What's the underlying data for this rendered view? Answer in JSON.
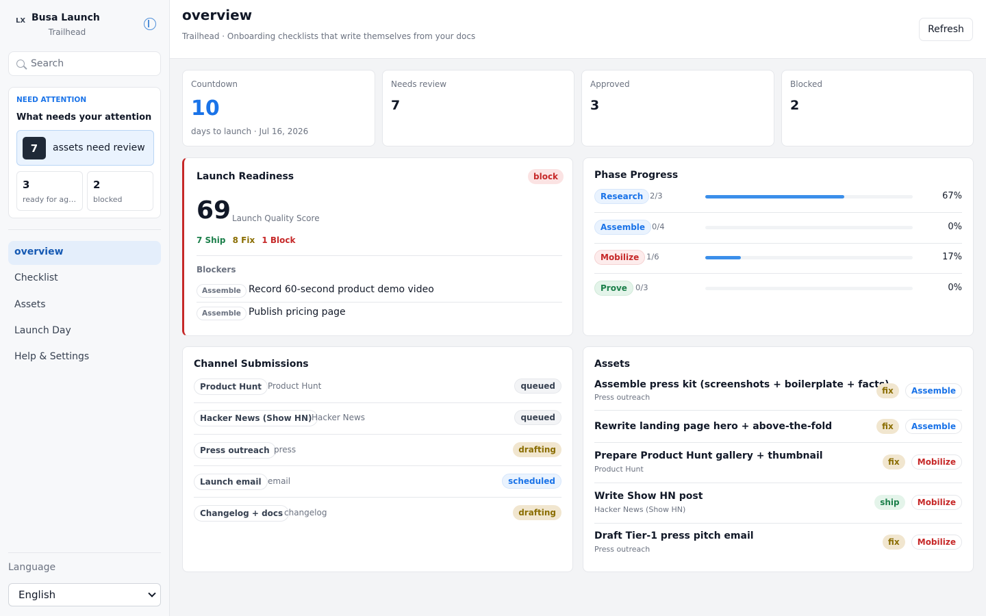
{
  "brand": {
    "logo": "LX",
    "title": "Busa Launch",
    "subtitle": "Trailhead"
  },
  "search": {
    "placeholder": "Search"
  },
  "attention": {
    "kicker": "NEED ATTENTION",
    "title": "What needs your attention",
    "review_count": "7",
    "review_label": "assets need review",
    "ready_count": "3",
    "ready_label": "ready for age…",
    "blocked_count": "2",
    "blocked_label": "blocked"
  },
  "nav": [
    "overview",
    "Checklist",
    "Assets",
    "Launch Day",
    "Help & Settings"
  ],
  "language": {
    "label": "Language",
    "value": "English"
  },
  "header": {
    "title": "overview",
    "subtitle": "Trailhead · Onboarding checklists that write themselves from your docs",
    "refresh": "Refresh"
  },
  "stats": {
    "countdown": {
      "label": "Countdown",
      "value": "10",
      "note": "days to launch · Jul 16, 2026"
    },
    "review": {
      "label": "Needs review",
      "value": "7"
    },
    "approved": {
      "label": "Approved",
      "value": "3"
    },
    "blocked": {
      "label": "Blocked",
      "value": "2"
    }
  },
  "readiness": {
    "title": "Launch Readiness",
    "badge": "block",
    "score": "69",
    "score_label": "Launch Quality Score",
    "ship": "7 Ship",
    "fix": "8 Fix",
    "block": "1 Block",
    "blockers_label": "Blockers",
    "blockers": [
      {
        "phase": "Assemble",
        "text": "Record 60-second product demo video"
      },
      {
        "phase": "Assemble",
        "text": "Publish pricing page"
      }
    ]
  },
  "phases": {
    "title": "Phase Progress",
    "items": [
      {
        "name": "Research",
        "count": "2/3",
        "pct": "67%",
        "progress": 0.67
      },
      {
        "name": "Assemble",
        "count": "0/4",
        "pct": "0%",
        "progress": 0
      },
      {
        "name": "Mobilize",
        "count": "1/6",
        "pct": "17%",
        "progress": 0.17
      },
      {
        "name": "Prove",
        "count": "0/3",
        "pct": "0%",
        "progress": 0
      }
    ]
  },
  "channels": {
    "title": "Channel Submissions",
    "items": [
      {
        "name": "Product Hunt",
        "target": "Product Hunt",
        "status": "queued"
      },
      {
        "name": "Hacker News (Show HN)",
        "target": "Hacker News",
        "status": "queued"
      },
      {
        "name": "Press outreach",
        "target": "press",
        "status": "drafting"
      },
      {
        "name": "Launch email",
        "target": "email",
        "status": "scheduled"
      },
      {
        "name": "Changelog + docs",
        "target": "changelog",
        "status": "drafting"
      }
    ]
  },
  "assets": {
    "title": "Assets",
    "items": [
      {
        "title": "Assemble press kit (screenshots + boilerplate + facts)",
        "sub": "Press outreach",
        "verdict": "fix",
        "phase": "Assemble"
      },
      {
        "title": "Rewrite landing page hero + above-the-fold",
        "sub": "",
        "verdict": "fix",
        "phase": "Assemble"
      },
      {
        "title": "Prepare Product Hunt gallery + thumbnail",
        "sub": "Product Hunt",
        "verdict": "fix",
        "phase": "Mobilize"
      },
      {
        "title": "Write Show HN post",
        "sub": "Hacker News (Show HN)",
        "verdict": "ship",
        "phase": "Mobilize"
      },
      {
        "title": "Draft Tier-1 press pitch email",
        "sub": "Press outreach",
        "verdict": "fix",
        "phase": "Mobilize"
      }
    ]
  },
  "colors": {
    "accent": "#1a73e8",
    "block": "#c62828",
    "ship": "#1b7f4a",
    "fix": "#8a6d00"
  }
}
